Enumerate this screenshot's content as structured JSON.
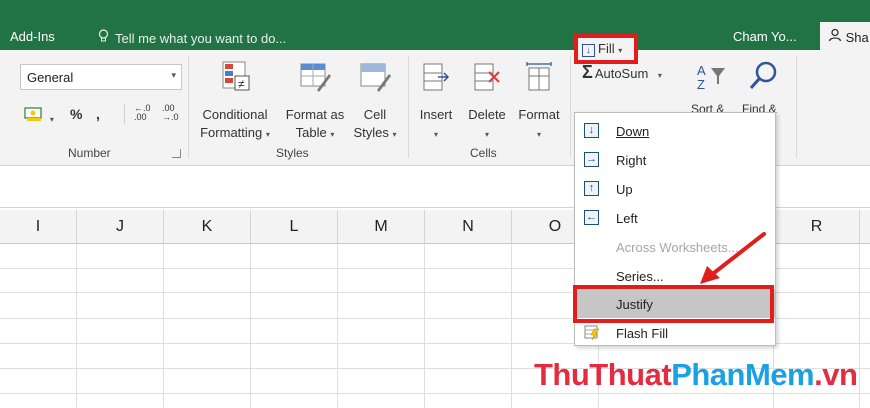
{
  "tabs": {
    "addins": "Add-Ins",
    "tellme": "Tell me what you want to do...",
    "user": "Cham Yo...",
    "share": "Sha"
  },
  "number_group": {
    "format_value": "General",
    "percent": "%",
    "comma": ",",
    "inc_decimal": ".00",
    "dec_decimal": ".0",
    "label": "Number"
  },
  "styles_group": {
    "conditional": [
      "Conditional",
      "Formatting"
    ],
    "format_as_table": [
      "Format as",
      "Table"
    ],
    "cell_styles": [
      "Cell",
      "Styles"
    ],
    "label": "Styles"
  },
  "cells_group": {
    "insert": "Insert",
    "delete": "Delete",
    "format": "Format",
    "label": "Cells"
  },
  "editing_group": {
    "autosum": "AutoSum",
    "fill": "Fill",
    "sort_filter": "Sort &",
    "find_select": "Find &"
  },
  "columns": [
    "I",
    "J",
    "K",
    "L",
    "M",
    "N",
    "O",
    "R"
  ],
  "fill_menu": {
    "items": [
      {
        "label": "Down",
        "icon": "fill-down-icon",
        "glyph": "↓"
      },
      {
        "label": "Right",
        "icon": "fill-right-icon",
        "glyph": "→"
      },
      {
        "label": "Up",
        "icon": "fill-up-icon",
        "glyph": "↑"
      },
      {
        "label": "Left",
        "icon": "fill-left-icon",
        "glyph": "←"
      },
      {
        "label": "Across Worksheets...",
        "disabled": true
      },
      {
        "label": "Series..."
      },
      {
        "label": "Justify",
        "highlighted": true
      },
      {
        "label": "Flash Fill",
        "icon": "flash-fill-icon"
      }
    ]
  },
  "watermark": {
    "part1": "ThuThuat",
    "part2": "PhanMem",
    "part3": ".vn"
  },
  "colors": {
    "excel_green": "#217346",
    "highlight_red": "#e01e1e",
    "ribbon_bg": "#f3f3f3"
  }
}
